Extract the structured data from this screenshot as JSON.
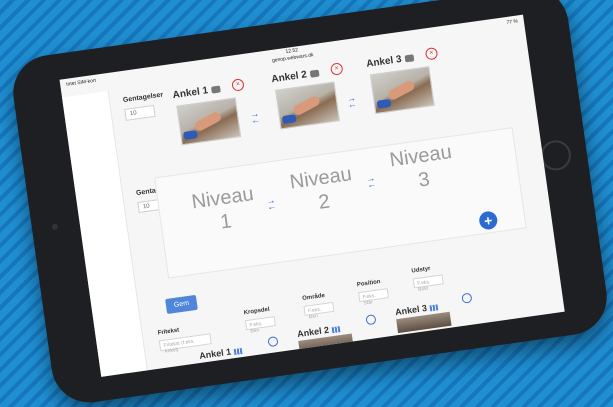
{
  "status": {
    "left": "Intet SIM-kort",
    "time": "12.52",
    "url": "genop.webwars.dk",
    "battery": "77 %"
  },
  "top": {
    "repetitions_label": "Gentagelser",
    "repetitions_value": "10",
    "cards": [
      {
        "title": "Ankel 1"
      },
      {
        "title": "Ankel 2"
      },
      {
        "title": "Ankel 3"
      }
    ]
  },
  "levels": {
    "repetitions_label": "Gentagelser",
    "repetitions_value": "10",
    "items": [
      {
        "word": "Niveau",
        "number": "1"
      },
      {
        "word": "Niveau",
        "number": "2"
      },
      {
        "word": "Niveau",
        "number": "3"
      }
    ]
  },
  "form": {
    "save_label": "Gem",
    "free_text_label": "Fritekst",
    "free_text_placeholder": "Fritekst (f.eks. Ankel)",
    "body_part_label": "Kropsdel",
    "body_part_placeholder": "F.eks. Ben",
    "area_label": "Område",
    "area_placeholder": "F.eks. Ben",
    "position_label": "Position",
    "position_placeholder": "F.eks. Står",
    "equipment_label": "Udstyr",
    "equipment_placeholder": "F.eks. Bold"
  },
  "results": [
    {
      "title": "Ankel 1"
    },
    {
      "title": "Ankel 2"
    },
    {
      "title": "Ankel 3"
    }
  ]
}
